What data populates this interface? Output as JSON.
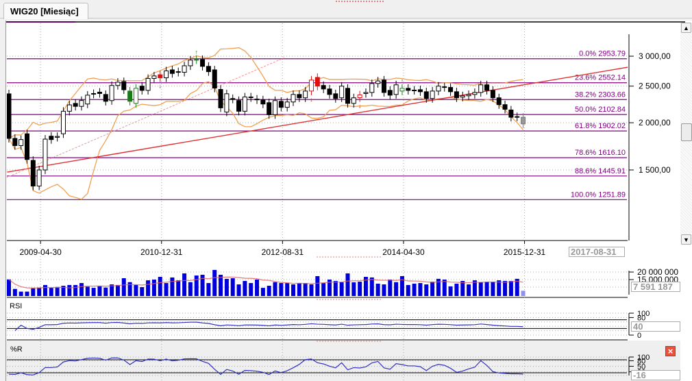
{
  "tab": {
    "title": "WIG20 [Miesiąc]"
  },
  "price_panel": {
    "y_ticks": [
      {
        "value": 3000,
        "label": "3 000,00"
      },
      {
        "value": 2500,
        "label": "2 500,00"
      },
      {
        "value": 2000,
        "label": "2 000,00"
      },
      {
        "value": 1500,
        "label": "1 500,00"
      }
    ],
    "fibonacci": [
      {
        "label": "0.0% 2953.79",
        "value": 2953.79
      },
      {
        "label": "23.6% 2552.14",
        "value": 2552.14
      },
      {
        "label": "38.2% 2303.66",
        "value": 2303.66
      },
      {
        "label": "50.0% 2102.84",
        "value": 2102.84
      },
      {
        "label": "61.8% 1902.02",
        "value": 1902.02
      },
      {
        "label": "78.6% 1616.10",
        "value": 1616.1
      },
      {
        "label": "88.6% 1445.91",
        "value": 1445.91
      },
      {
        "label": "100.0% 1251.89",
        "value": 1251.89
      }
    ],
    "x_labels": [
      {
        "label": "2009-04-30",
        "index": 6
      },
      {
        "label": "2010-12-31",
        "index": 26
      },
      {
        "label": "2012-08-31",
        "index": 46
      },
      {
        "label": "2014-04-30",
        "index": 66
      },
      {
        "label": "2015-12-31",
        "index": 86
      }
    ],
    "cursor_date": "2017-08-31"
  },
  "volume_panel": {
    "y_ticks": [
      "20 000 000",
      "15 000 000"
    ],
    "readout": "7 591 187"
  },
  "rsi_panel": {
    "title": "RSI",
    "y_ticks": [
      "100",
      "80",
      "0"
    ],
    "readout": "40"
  },
  "wr_panel": {
    "title": "%R",
    "y_ticks": [
      "100",
      "80",
      "50",
      "20"
    ],
    "readout": "-16"
  },
  "colors": {
    "bull": "#ffffff",
    "bear": "#000000",
    "signal_up": "#1a7a1a",
    "signal_down": "#e01010",
    "fib": "#800080",
    "bands": "#f0a050",
    "trend": "#e03030",
    "volume": "#0000dd"
  },
  "chart_data": {
    "type": "candlestick",
    "title": "WIG20 [Miesiąc]",
    "scale": "log",
    "ylim": [
      1100,
      3400
    ],
    "first_period": "2008-10",
    "period": "month",
    "candles_open_close": [
      [
        2385,
        1818
      ],
      [
        1818,
        1740
      ],
      [
        1740,
        1805
      ],
      [
        1870,
        1599
      ],
      [
        1590,
        1360
      ],
      [
        1360,
        1500
      ],
      [
        1500,
        1810
      ],
      [
        1843,
        1805
      ],
      [
        1830,
        1840
      ],
      [
        1870,
        2145
      ],
      [
        2145,
        2230
      ],
      [
        2250,
        2210
      ],
      [
        2210,
        2290
      ],
      [
        2242,
        2366
      ],
      [
        2380,
        2390
      ],
      [
        2410,
        2390
      ],
      [
        2376,
        2279
      ],
      [
        2289,
        2510
      ],
      [
        2510,
        2560
      ],
      [
        2570,
        2445
      ],
      [
        2426,
        2279
      ],
      [
        2250,
        2467
      ],
      [
        2500,
        2436
      ],
      [
        2436,
        2620
      ],
      [
        2620,
        2660
      ],
      [
        2680,
        2630
      ],
      [
        2630,
        2744
      ],
      [
        2760,
        2700
      ],
      [
        2730,
        2720
      ],
      [
        2720,
        2830
      ],
      [
        2830,
        2930
      ],
      [
        2940,
        2935
      ],
      [
        2940,
        2820
      ],
      [
        2820,
        2730
      ],
      [
        2760,
        2470
      ],
      [
        2450,
        2190
      ],
      [
        2135,
        2386
      ],
      [
        2318,
        2310
      ],
      [
        2290,
        2145
      ],
      [
        2145,
        2340
      ],
      [
        2340,
        2330
      ],
      [
        2310,
        2300
      ],
      [
        2299,
        2242
      ],
      [
        2260,
        2101
      ],
      [
        2101,
        2289
      ],
      [
        2279,
        2197
      ],
      [
        2197,
        2270
      ],
      [
        2270,
        2376
      ],
      [
        2376,
        2328
      ],
      [
        2328,
        2426
      ],
      [
        2426,
        2594
      ],
      [
        2636,
        2500
      ],
      [
        2510,
        2457
      ],
      [
        2457,
        2376
      ],
      [
        2386,
        2318
      ],
      [
        2328,
        2500
      ],
      [
        2467,
        2250
      ],
      [
        2250,
        2328
      ],
      [
        2330,
        2370
      ],
      [
        2390,
        2405
      ],
      [
        2405,
        2540
      ],
      [
        2540,
        2580
      ],
      [
        2594,
        2405
      ],
      [
        2436,
        2366
      ],
      [
        2376,
        2520
      ],
      [
        2426,
        2467
      ],
      [
        2467,
        2436
      ],
      [
        2440,
        2436
      ],
      [
        2446,
        2416
      ],
      [
        2416,
        2318
      ],
      [
        2318,
        2426
      ],
      [
        2426,
        2500
      ],
      [
        2490,
        2480
      ],
      [
        2480,
        2416
      ],
      [
        2416,
        2328
      ],
      [
        2337,
        2357
      ],
      [
        2357,
        2376
      ],
      [
        2376,
        2405
      ],
      [
        2405,
        2520
      ],
      [
        2520,
        2436
      ],
      [
        2436,
        2328
      ],
      [
        2328,
        2233
      ],
      [
        2233,
        2171
      ],
      [
        2162,
        2068
      ],
      [
        2076,
        2070
      ],
      [
        2068,
        1986
      ]
    ],
    "signal_up_candles": [
      20,
      21,
      31,
      65
    ],
    "signal_down_candles": [
      25,
      50,
      51,
      58
    ],
    "buy_arrows": [
      31,
      65
    ],
    "sell_arrows": [
      25,
      50,
      58
    ],
    "volume_millions": [
      15.1,
      8.8,
      7.0,
      7.0,
      9.2,
      9.7,
      11.4,
      9.5,
      10.1,
      10.9,
      11.4,
      11.4,
      12.7,
      10.3,
      9.5,
      10.6,
      9.7,
      11.8,
      11.4,
      15.9,
      13.3,
      11.4,
      10.0,
      14.5,
      15.0,
      16.8,
      12.7,
      16.4,
      14.5,
      19.1,
      13.3,
      17.7,
      18.2,
      12.7,
      21.4,
      18.2,
      15.5,
      15.9,
      11.8,
      14.1,
      12.7,
      15.0,
      9.5,
      10.9,
      13.3,
      12.7,
      12.7,
      11.8,
      12.7,
      12.7,
      11.8,
      17.3,
      12.7,
      15.0,
      14.1,
      13.2,
      19.1,
      13.2,
      13.6,
      16.8,
      16.4,
      12.3,
      11.8,
      15.0,
      13.3,
      17.3,
      11.4,
      12.3,
      12.7,
      11.8,
      13.6,
      15.5,
      15.0,
      10.5,
      12.3,
      14.1,
      11.8,
      14.5,
      13.2,
      13.6,
      13.6,
      14.5,
      14.1,
      14.1,
      15.5,
      7.59
    ],
    "trendlines": [
      {
        "name": "support",
        "from": {
          "index": -0.3,
          "value": 1480
        },
        "to": {
          "index": 112,
          "value": 2980
        }
      },
      {
        "name": "dashed",
        "from": {
          "index": -0.5,
          "value": 1430
        },
        "to": {
          "index": 45.5,
          "value": 2970
        }
      }
    ]
  }
}
